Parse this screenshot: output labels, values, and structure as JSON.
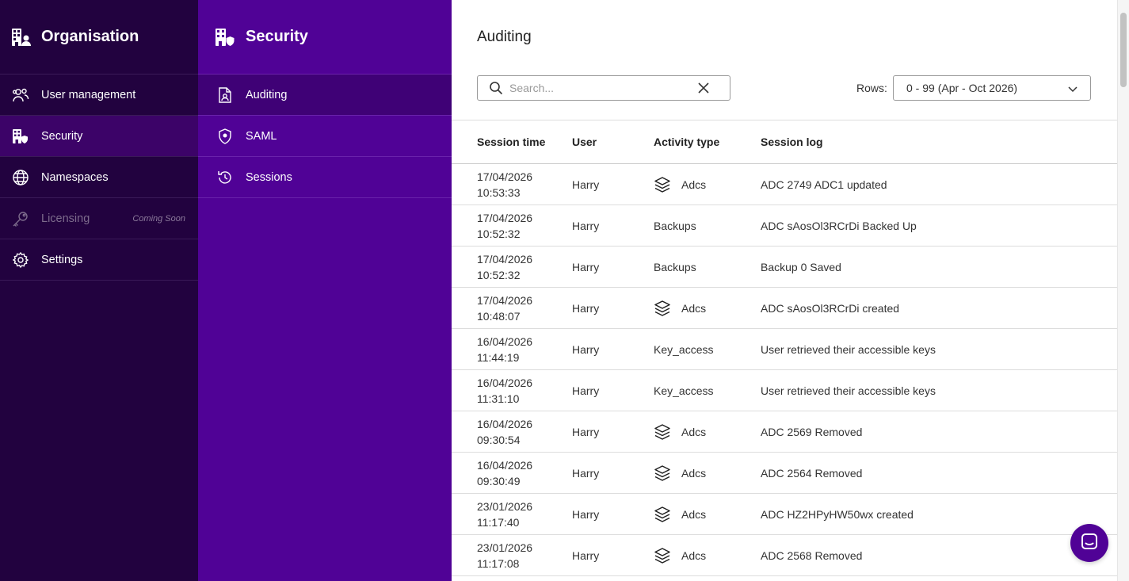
{
  "org_sidebar": {
    "title": "Organisation",
    "items": [
      {
        "label": "User management",
        "icon": "users-icon"
      },
      {
        "label": "Security",
        "icon": "building-shield-icon"
      },
      {
        "label": "Namespaces",
        "icon": "globe-icon"
      },
      {
        "label": "Licensing",
        "icon": "key-icon",
        "badge": "Coming Soon"
      },
      {
        "label": "Settings",
        "icon": "gear-icon"
      }
    ]
  },
  "security_sidebar": {
    "title": "Security",
    "items": [
      {
        "label": "Auditing",
        "icon": "audit-document-icon"
      },
      {
        "label": "SAML",
        "icon": "shield-icon"
      },
      {
        "label": "Sessions",
        "icon": "history-icon"
      }
    ]
  },
  "main": {
    "title": "Auditing",
    "search": {
      "placeholder": "Search...",
      "value": ""
    },
    "rows_label": "Rows:",
    "rows_select": "0 - 99 (Apr - Oct 2026)",
    "table": {
      "headers": [
        "Session time",
        "User",
        "Activity type",
        "Session log"
      ],
      "rows": [
        {
          "date": "17/04/2026",
          "time": "10:53:33",
          "user": "Harry",
          "activity": "Adcs",
          "layers": true,
          "log": "ADC 2749 ADC1 updated"
        },
        {
          "date": "17/04/2026",
          "time": "10:52:32",
          "user": "Harry",
          "activity": "Backups",
          "layers": false,
          "log": "ADC sAosOl3RCrDi Backed Up"
        },
        {
          "date": "17/04/2026",
          "time": "10:52:32",
          "user": "Harry",
          "activity": "Backups",
          "layers": false,
          "log": "Backup 0 Saved"
        },
        {
          "date": "17/04/2026",
          "time": "10:48:07",
          "user": "Harry",
          "activity": "Adcs",
          "layers": true,
          "log": "ADC sAosOl3RCrDi created"
        },
        {
          "date": "16/04/2026",
          "time": "11:44:19",
          "user": "Harry",
          "activity": "Key_access",
          "layers": false,
          "log": "User retrieved their accessible keys"
        },
        {
          "date": "16/04/2026",
          "time": "11:31:10",
          "user": "Harry",
          "activity": "Key_access",
          "layers": false,
          "log": "User retrieved their accessible keys"
        },
        {
          "date": "16/04/2026",
          "time": "09:30:54",
          "user": "Harry",
          "activity": "Adcs",
          "layers": true,
          "log": "ADC 2569 Removed"
        },
        {
          "date": "16/04/2026",
          "time": "09:30:49",
          "user": "Harry",
          "activity": "Adcs",
          "layers": true,
          "log": "ADC 2564 Removed"
        },
        {
          "date": "23/01/2026",
          "time": "11:17:40",
          "user": "Harry",
          "activity": "Adcs",
          "layers": true,
          "log": "ADC HZ2HPyHW50wx created"
        },
        {
          "date": "23/01/2026",
          "time": "11:17:08",
          "user": "Harry",
          "activity": "Adcs",
          "layers": true,
          "log": "ADC 2568 Removed"
        }
      ]
    }
  },
  "colors": {
    "org_sidebar_bg": "#22023f",
    "security_sidebar_bg": "#500296",
    "accent": "#500296"
  }
}
